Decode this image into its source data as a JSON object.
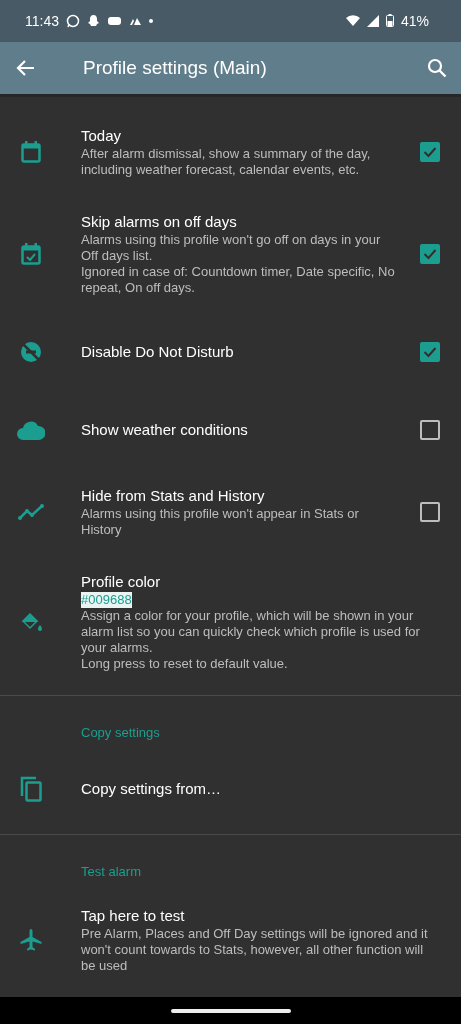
{
  "status_bar": {
    "time": "11:43",
    "battery": "41%"
  },
  "app_bar": {
    "title": "Profile settings (Main)"
  },
  "sections": [
    {
      "items": [
        {
          "title": "Today",
          "summary": "After alarm dismissal, show a summary of the day, including weather forecast, calendar events, etc.",
          "checked": true
        },
        {
          "title": "Skip alarms on off days",
          "summary": "Alarms using this profile won't go off on days in your Off days list.\nIgnored in case of: Countdown timer, Date specific, No repeat, On off days.",
          "checked": true
        },
        {
          "title": "Disable Do Not Disturb",
          "checked": true
        },
        {
          "title": "Show weather conditions",
          "checked": false
        },
        {
          "title": "Hide from Stats and History",
          "summary": "Alarms using this profile won't appear in Stats or History",
          "checked": false
        },
        {
          "title": "Profile color",
          "value": "#009688",
          "summary": "Assign a color for your profile, which will be shown in your alarm list so you can quickly check which profile is used for your alarms.\nLong press to reset to default value."
        }
      ]
    },
    {
      "header": "Copy settings",
      "items": [
        {
          "title": "Copy settings from…"
        }
      ]
    },
    {
      "header": "Test alarm",
      "items": [
        {
          "title": "Tap here to test",
          "summary": "Pre Alarm, Places and Off Day settings will be ignored and it won't count towards to Stats, however, all other function will be used"
        }
      ]
    }
  ]
}
